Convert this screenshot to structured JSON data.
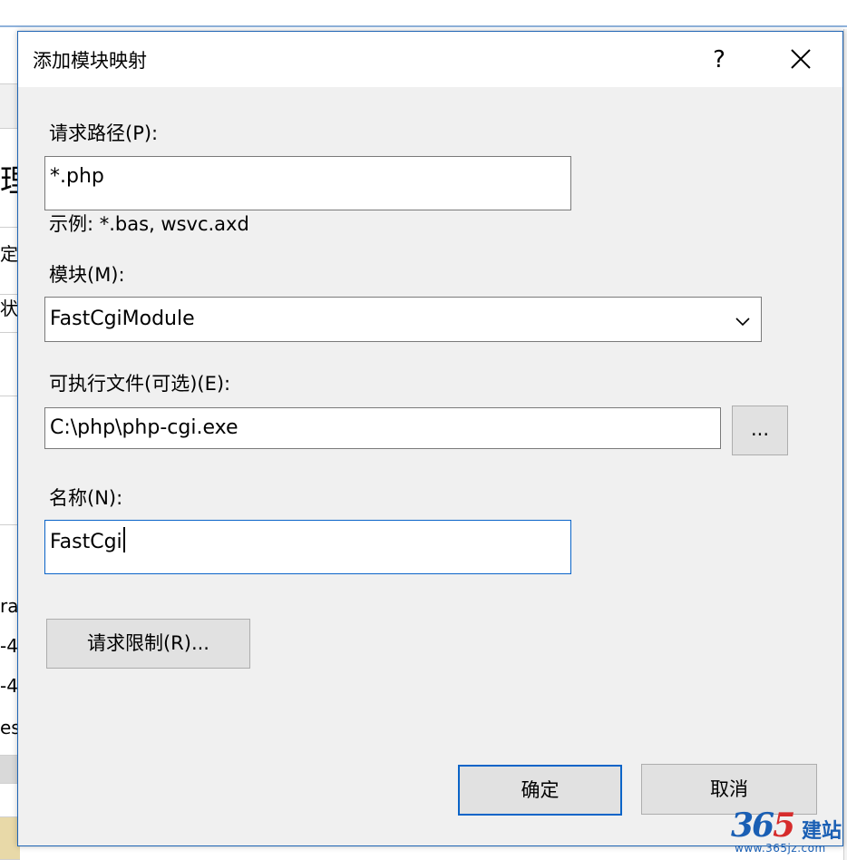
{
  "background": {
    "fragments": [
      "理",
      "定",
      "状",
      "ra",
      "-4",
      "-4",
      "es"
    ]
  },
  "dialog": {
    "title": "添加模块映射",
    "help_glyph": "?",
    "request_path": {
      "label": "请求路径(P):",
      "value": "*.php",
      "hint": "示例: *.bas, wsvc.axd"
    },
    "module": {
      "label": "模块(M):",
      "selected": "FastCgiModule"
    },
    "executable": {
      "label": "可执行文件(可选)(E):",
      "value": "C:\\php\\php-cgi.exe",
      "browse_label": "..."
    },
    "name": {
      "label": "名称(N):",
      "value": "FastCgi"
    },
    "request_restrictions_label": "请求限制(R)...",
    "ok_label": "确定",
    "cancel_label": "取消"
  },
  "watermark": {
    "number_a": "36",
    "number_b": "5",
    "chinese": "建站",
    "url": "www.365jz.com"
  },
  "colors": {
    "accent": "#0a64c8",
    "dialog_bg": "#f0f0f0",
    "button_bg": "#e1e1e1"
  }
}
